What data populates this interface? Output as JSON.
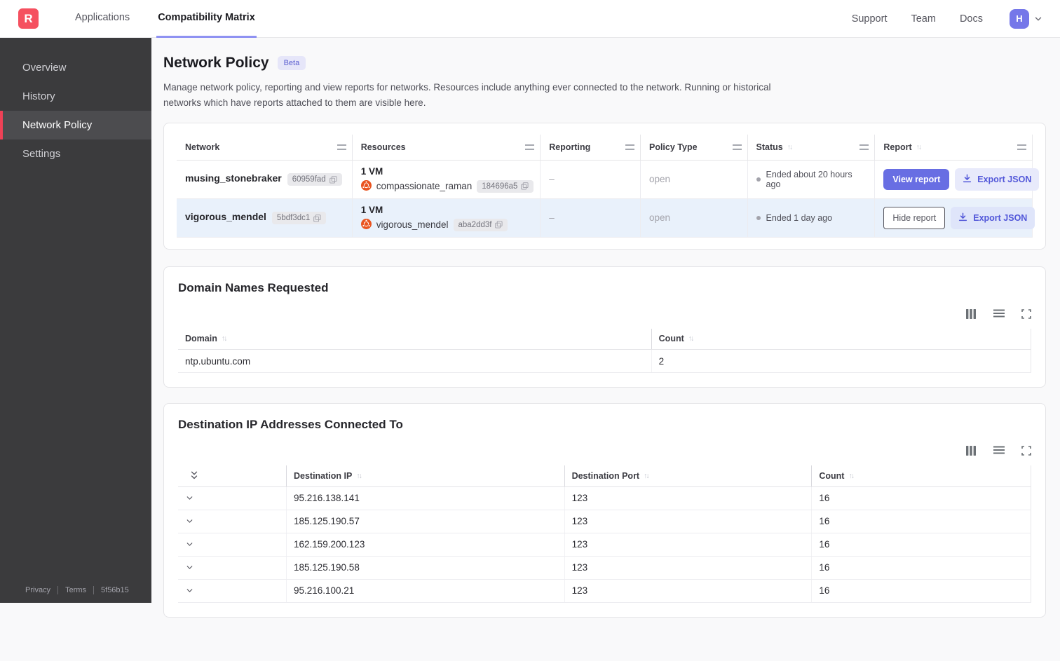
{
  "navbar": {
    "logo_letter": "R",
    "tabs": [
      {
        "label": "Applications",
        "active": false
      },
      {
        "label": "Compatibility Matrix",
        "active": true
      }
    ],
    "links": {
      "support": "Support",
      "team": "Team",
      "docs": "Docs"
    },
    "avatar_letter": "H"
  },
  "sidebar": {
    "items": [
      {
        "label": "Overview",
        "active": false
      },
      {
        "label": "History",
        "active": false
      },
      {
        "label": "Network Policy",
        "active": true
      },
      {
        "label": "Settings",
        "active": false
      }
    ],
    "footer": {
      "privacy": "Privacy",
      "terms": "Terms",
      "version": "5f56b15"
    }
  },
  "page": {
    "title": "Network Policy",
    "badge": "Beta",
    "description": "Manage network policy, reporting and view reports for networks. Resources include anything ever connected to the network. Running or historical networks which have reports attached to them are visible here."
  },
  "networks_table": {
    "headers": {
      "network": "Network",
      "resources": "Resources",
      "reporting": "Reporting",
      "policy_type": "Policy Type",
      "status": "Status",
      "report": "Report"
    },
    "rows": [
      {
        "network_name": "musing_stonebraker",
        "network_id": "60959fad",
        "vm_count": "1 VM",
        "resource_name": "compassionate_raman",
        "resource_id": "184696a5",
        "reporting": "–",
        "policy_type": "open",
        "status": "Ended about 20 hours ago",
        "report_button": "View report",
        "export_label": "Export JSON"
      },
      {
        "network_name": "vigorous_mendel",
        "network_id": "5bdf3dc1",
        "vm_count": "1 VM",
        "resource_name": "vigorous_mendel",
        "resource_id": "aba2dd3f",
        "reporting": "–",
        "policy_type": "open",
        "status": "Ended 1 day ago",
        "report_button": "Hide report",
        "export_label": "Export JSON"
      }
    ]
  },
  "domains_card": {
    "title": "Domain Names Requested",
    "headers": {
      "domain": "Domain",
      "count": "Count"
    },
    "rows": [
      {
        "domain": "ntp.ubuntu.com",
        "count": "2"
      }
    ]
  },
  "ips_card": {
    "title": "Destination IP Addresses Connected To",
    "headers": {
      "ip": "Destination IP",
      "port": "Destination Port",
      "count": "Count"
    },
    "rows": [
      {
        "ip": "95.216.138.141",
        "port": "123",
        "count": "16"
      },
      {
        "ip": "185.125.190.57",
        "port": "123",
        "count": "16"
      },
      {
        "ip": "162.159.200.123",
        "port": "123",
        "count": "16"
      },
      {
        "ip": "185.125.190.58",
        "port": "123",
        "count": "16"
      },
      {
        "ip": "95.216.100.21",
        "port": "123",
        "count": "16"
      }
    ]
  },
  "colors": {
    "brand_red": "#f5505f",
    "sidebar_accent_red": "#ef4156",
    "primary_indigo": "#686ee3",
    "tab_underline": "#8f92f2",
    "avatar_purple": "#7577e9",
    "row_highlight": "#e9f1fb",
    "ubuntu_orange": "#e95420"
  }
}
